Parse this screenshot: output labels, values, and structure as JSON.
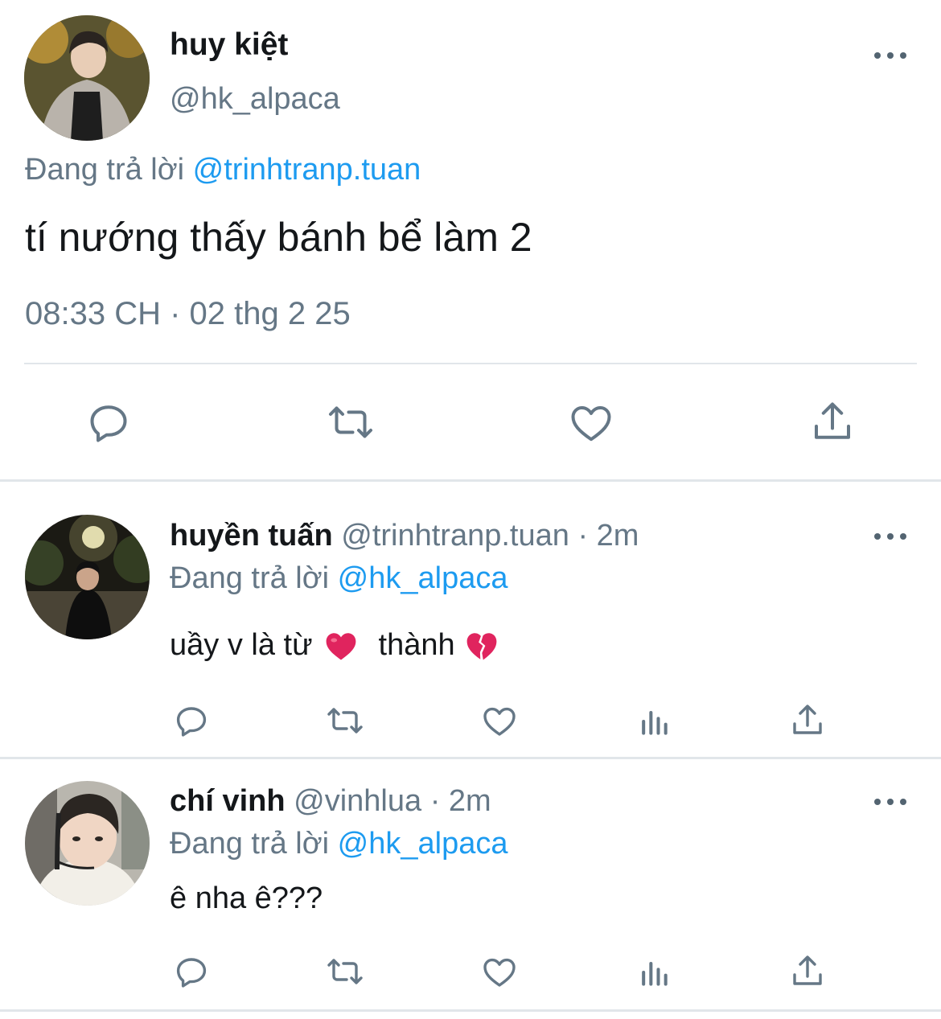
{
  "main_tweet": {
    "display_name": "huy kiệt",
    "handle": "@hk_alpaca",
    "reply_prefix": "Đang trả lời",
    "reply_to": "@trinhtranp.tuan",
    "text": "tí nướng thấy bánh bể làm 2",
    "timestamp": "08:33 CH · 02 thg 2 25",
    "actions": [
      "reply-icon",
      "retweet-icon",
      "like-icon",
      "share-icon"
    ]
  },
  "replies": [
    {
      "display_name": "huyền tuấn",
      "handle": "@trinhtranp.tuan",
      "separator": "·",
      "time": "2m",
      "reply_prefix": "Đang trả lời",
      "reply_to": "@hk_alpaca",
      "text_part1": "uầy v là từ",
      "emoji1": "❤️",
      "text_part2": "thành",
      "emoji2": "💔",
      "actions": [
        "reply-icon",
        "retweet-icon",
        "like-icon",
        "analytics-icon",
        "share-icon"
      ]
    },
    {
      "display_name": "chí vinh",
      "handle": "@vinhlua",
      "separator": "·",
      "time": "2m",
      "reply_prefix": "Đang trả lời",
      "reply_to": "@hk_alpaca",
      "text": "ê nha ê???",
      "actions": [
        "reply-icon",
        "retweet-icon",
        "like-icon",
        "analytics-icon",
        "share-icon"
      ]
    }
  ],
  "colors": {
    "link": "#1d9bf0",
    "secondary_text": "#657786",
    "divider": "#e1e6ea",
    "heart_emoji": "#e0245e"
  }
}
